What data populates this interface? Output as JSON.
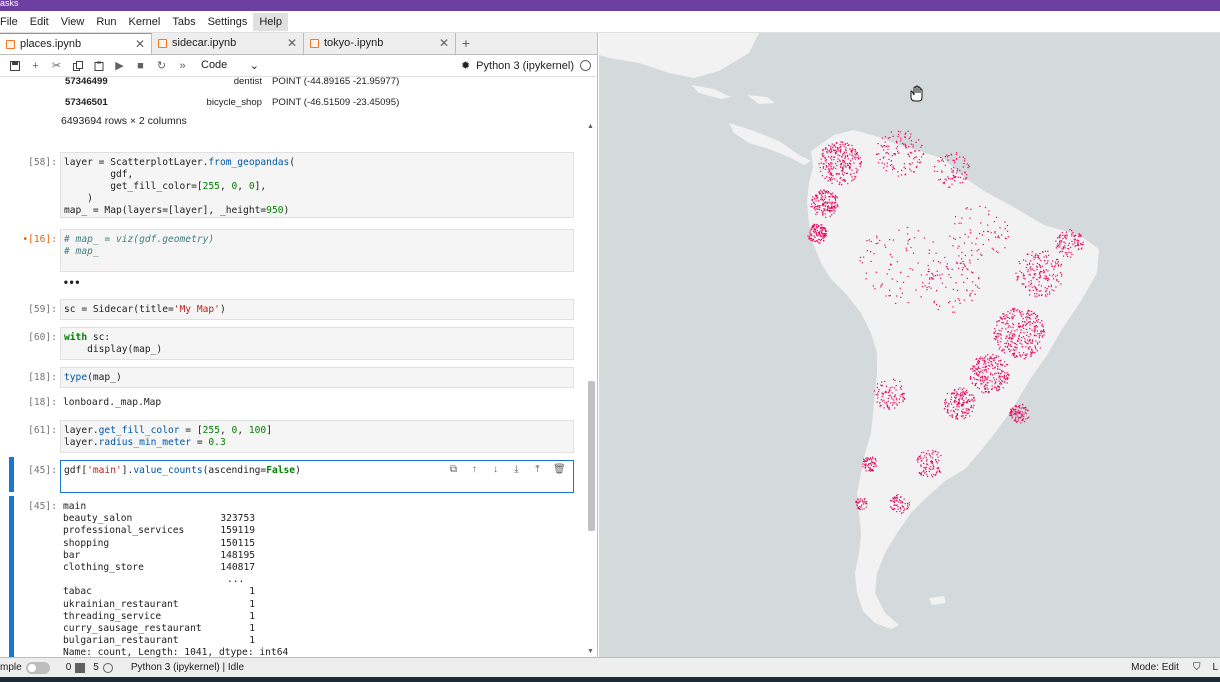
{
  "window": {
    "title_fragment": "asks"
  },
  "menu": [
    "File",
    "Edit",
    "View",
    "Run",
    "Kernel",
    "Tabs",
    "Settings",
    "Help"
  ],
  "tabs": [
    {
      "label": "places.ipynb",
      "close": "✕"
    },
    {
      "label": "sidecar.ipynb",
      "close": "✕"
    },
    {
      "label": "tokyo-.ipynb",
      "close": "✕"
    }
  ],
  "toolbar": {
    "cell_type": "Code",
    "kernel": "Python 3 (ipykernel)"
  },
  "dataframe_tail": {
    "rows": [
      {
        "index": "57346499",
        "main": "dentist",
        "geometry": "POINT (-44.89165 -21.95977)"
      },
      {
        "index": "57346501",
        "main": "bicycle_shop",
        "geometry": "POINT (-46.51509 -23.45095)"
      }
    ],
    "summary": "6493694 rows × 2 columns"
  },
  "cells": {
    "c58": {
      "prompt": "[58]:"
    },
    "c16": {
      "prompt": "•[16]:"
    },
    "ellipsis": "•••",
    "c59": {
      "prompt": "[59]:"
    },
    "c60": {
      "prompt": "[60]:"
    },
    "c18": {
      "prompt": "[18]:",
      "out_prompt": "[18]:",
      "output": "lonboard._map.Map"
    },
    "c61": {
      "prompt": "[61]:"
    },
    "c45": {
      "prompt": "[45]:",
      "out_prompt": "[45]:"
    }
  },
  "value_counts": {
    "header": "main",
    "top": [
      {
        "name": "beauty_salon",
        "count": "323753"
      },
      {
        "name": "professional_services",
        "count": "159119"
      },
      {
        "name": "shopping",
        "count": "150115"
      },
      {
        "name": "bar",
        "count": "148195"
      },
      {
        "name": "clothing_store",
        "count": "140817"
      }
    ],
    "gap": "...",
    "bottom": [
      {
        "name": "tabac",
        "count": "1"
      },
      {
        "name": "ukrainian_restaurant",
        "count": "1"
      },
      {
        "name": "threading_service",
        "count": "1"
      },
      {
        "name": "curry_sausage_restaurant",
        "count": "1"
      },
      {
        "name": "bulgarian_restaurant",
        "count": "1"
      }
    ],
    "footer": "Name: count, Length: 1041, dtype: int64"
  },
  "status": {
    "mode_label": "mple",
    "count_a": "0",
    "count_b": "5",
    "kernel_status": "Python 3 (ipykernel) | Idle",
    "mode": "Mode: Edit",
    "extra": "L"
  },
  "colors": {
    "accent": "#1976d2",
    "points": "#e8005a",
    "titlebar": "#6c3fa0",
    "tab_accent": "#f37726"
  },
  "icons": [
    "save-icon",
    "add-icon",
    "cut-icon",
    "copy-icon",
    "paste-icon",
    "run-icon",
    "stop-icon",
    "restart-icon",
    "fast-forward-icon",
    "bug-icon",
    "duplicate-icon",
    "move-up-icon",
    "move-down-icon",
    "insert-below-icon",
    "insert-above-icon",
    "delete-icon",
    "hand-cursor-icon"
  ]
}
